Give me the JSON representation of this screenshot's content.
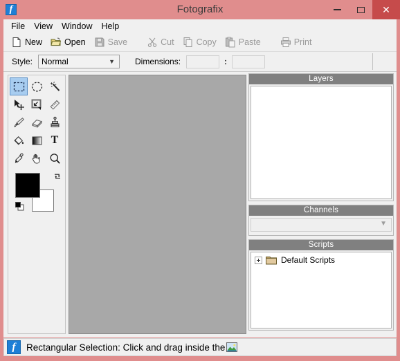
{
  "window": {
    "title": "Fotografix",
    "app_icon": "fotografix-f-icon",
    "frame_color": "#e08d8d",
    "titlebar_buttons": {
      "minimize_label": "–",
      "maximize_label": "□",
      "close_label": "✕",
      "close_bg": "#c64b4b"
    }
  },
  "menubar": {
    "items": [
      {
        "label": "File"
      },
      {
        "label": "View"
      },
      {
        "label": "Window"
      },
      {
        "label": "Help"
      }
    ]
  },
  "toolbar": {
    "buttons": [
      {
        "label": "New",
        "icon": "new-page-icon",
        "enabled": true
      },
      {
        "label": "Open",
        "icon": "open-folder-icon",
        "enabled": true
      },
      {
        "label": "Save",
        "icon": "save-floppy-icon",
        "enabled": false
      },
      {
        "label": "Cut",
        "icon": "scissors-icon",
        "enabled": false
      },
      {
        "label": "Copy",
        "icon": "copy-icon",
        "enabled": false
      },
      {
        "label": "Paste",
        "icon": "paste-icon",
        "enabled": false
      },
      {
        "label": "Print",
        "icon": "printer-icon",
        "enabled": false
      }
    ]
  },
  "options_bar": {
    "style_label": "Style:",
    "style_value": "Normal",
    "style_options": [
      "Normal"
    ],
    "dimensions_label": "Dimensions:",
    "dimension_width": "",
    "dimension_height": "",
    "dimension_separator": ":"
  },
  "tools": {
    "selected": "rectangular-selection",
    "items": [
      {
        "name": "rectangular-selection-tool",
        "icon": "rectangular-marquee-icon",
        "selected": true
      },
      {
        "name": "elliptical-selection-tool",
        "icon": "elliptical-marquee-icon",
        "selected": false
      },
      {
        "name": "magic-wand-tool",
        "icon": "magic-wand-icon",
        "selected": false
      },
      {
        "name": "move-tool",
        "icon": "move-arrow-icon",
        "selected": false
      },
      {
        "name": "crop-tool",
        "icon": "crop-icon",
        "selected": false
      },
      {
        "name": "measure-tool",
        "icon": "ruler-icon",
        "selected": false
      },
      {
        "name": "brush-tool",
        "icon": "paintbrush-icon",
        "selected": false
      },
      {
        "name": "eraser-tool",
        "icon": "eraser-icon",
        "selected": false
      },
      {
        "name": "clone-stamp-tool",
        "icon": "clone-stamp-icon",
        "selected": false
      },
      {
        "name": "paint-bucket-tool",
        "icon": "paint-bucket-icon",
        "selected": false
      },
      {
        "name": "gradient-tool",
        "icon": "gradient-icon",
        "selected": false
      },
      {
        "name": "text-tool",
        "icon": "text-t-icon",
        "selected": false
      },
      {
        "name": "eyedropper-tool",
        "icon": "eyedropper-icon",
        "selected": false
      },
      {
        "name": "hand-tool",
        "icon": "hand-icon",
        "selected": false
      },
      {
        "name": "zoom-tool",
        "icon": "magnifier-icon",
        "selected": false
      }
    ],
    "colors": {
      "foreground": "#000000",
      "background": "#ffffff",
      "swap_icon": "swap-colors-icon",
      "default_icon": "default-colors-icon"
    }
  },
  "canvas": {
    "background_color": "#a8a8a8"
  },
  "panels": {
    "layers": {
      "title": "Layers",
      "items": []
    },
    "channels": {
      "title": "Channels",
      "selected_value": "",
      "options": []
    },
    "scripts": {
      "title": "Scripts",
      "tree": [
        {
          "label": "Default Scripts",
          "icon": "folder-icon",
          "expander": "plus-expander-icon",
          "expanded": false
        }
      ]
    }
  },
  "statusbar": {
    "icon": "fotografix-f-icon",
    "message": "Rectangular Selection: Click and drag inside the",
    "trailing_icon": "image-thumbnail-icon"
  }
}
